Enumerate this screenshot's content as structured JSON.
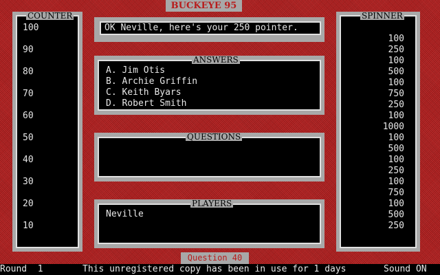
{
  "title": "BUCKEYE 95",
  "counter": {
    "label": "COUNTER",
    "values": [
      "100",
      "90",
      "80",
      "70",
      "60",
      "50",
      "40",
      "30",
      "20",
      "10"
    ]
  },
  "message": "OK Neville, here's your 250 pointer.",
  "answers": {
    "label": "ANSWERS",
    "items": [
      "A. Jim Otis",
      "B. Archie Griffin",
      "C. Keith Byars",
      "D. Robert Smith"
    ]
  },
  "questions": {
    "label": "QUESTIONS",
    "text": ""
  },
  "players": {
    "label": "PLAYERS",
    "items": [
      "Neville"
    ]
  },
  "spinner": {
    "label": "SPINNER",
    "values": [
      "100",
      "250",
      "100",
      "500",
      "100",
      "750",
      "250",
      "100",
      "1000",
      "100",
      "500",
      "100",
      "250",
      "100",
      "750",
      "100",
      "500",
      "250"
    ]
  },
  "question_tab": "Question  40",
  "status": {
    "round": "Round  1",
    "notice": "This unregistered copy has been in use for 1 days",
    "sound": "Sound ON"
  }
}
